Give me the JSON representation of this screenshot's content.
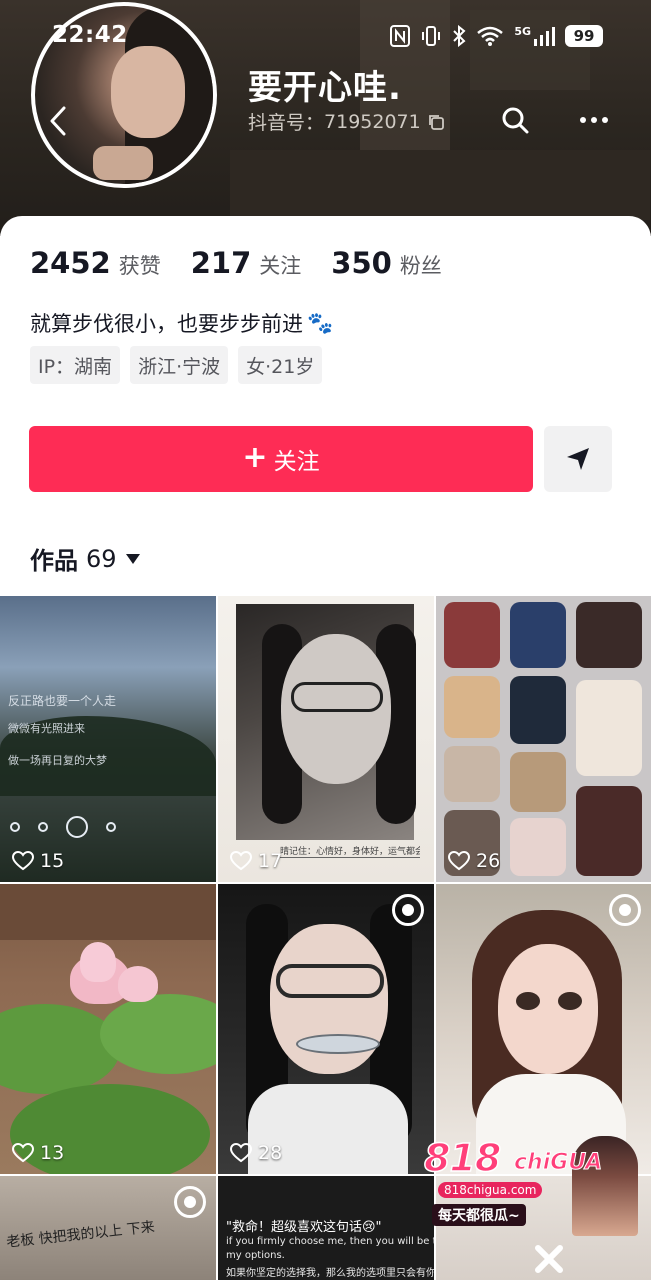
{
  "status_bar": {
    "time": "22:42",
    "battery": "99",
    "network": "5G"
  },
  "header": {
    "nickname": "要开心哇.",
    "id_label": "抖音号：",
    "id_value": "71952071",
    "back_icon": "chevron-left-icon",
    "search_icon": "search-icon",
    "more_icon": "more-horizontal-icon"
  },
  "stats": {
    "likes_count": "2452",
    "likes_label": "获赞",
    "following_count": "217",
    "following_label": "关注",
    "followers_count": "350",
    "followers_label": "粉丝"
  },
  "bio": {
    "text": "就算步伐很小，也要步步前进",
    "emoji": "🐾"
  },
  "tags": [
    "IP：湖南",
    "浙江·宁波",
    "女·21岁"
  ],
  "actions": {
    "follow_plus": "+",
    "follow_label": "关注",
    "share_icon": "send-icon"
  },
  "works": {
    "label": "作品",
    "count": "69"
  },
  "posts": [
    {
      "likes": "15",
      "lyrics": [
        "反正路也要一个人走",
        "微微有光照进来",
        "做一场再日复的大梦"
      ]
    },
    {
      "likes": "17",
      "caption": "晴记住：心情好，身体好，运气都会好"
    },
    {
      "likes": "26"
    },
    {
      "likes": "13"
    },
    {
      "likes": "28"
    },
    {
      "likes": ""
    },
    {
      "likes": "",
      "note": "老板 快把我的以上 下来"
    },
    {
      "likes": "",
      "lines": [
        "\"救命！超级喜欢这句话😢\"",
        "if you firmly choose me, then you will be the only one in",
        "my options.",
        "如果你坚定的选择我，那么我的选项里只会有你。"
      ]
    },
    {
      "likes": ""
    }
  ],
  "watermark": {
    "logo": "818",
    "brand": "chiGUA",
    "url": "818chigua.com",
    "slogan": "每天都很瓜~"
  },
  "colors": {
    "accent": "#fe2c55",
    "text_primary": "#161823",
    "text_secondary": "#5b5c61",
    "tag_bg": "#f2f2f3"
  }
}
